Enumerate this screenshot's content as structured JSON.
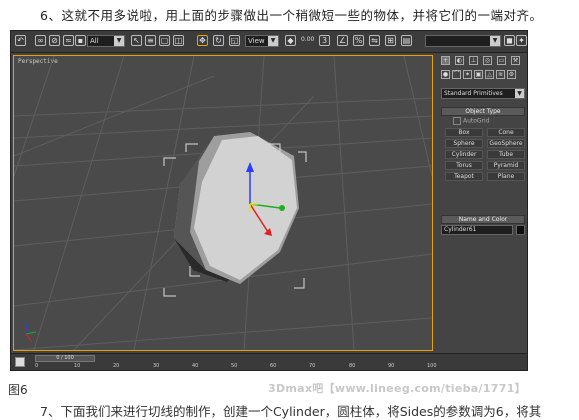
{
  "instruction_top": "6、这就不用多说啦，用上面的步骤做出一个稍微短一些的物体，并将它们的一端对齐。",
  "toolbar": {
    "selection_filter": "All",
    "reference_coord": "View",
    "icons": [
      "undo-icon",
      "link-icon",
      "unlink-icon",
      "bind-icon",
      "select-icon",
      "select-by-name-icon",
      "rect-region-icon",
      "window-crossing-icon",
      "move-icon",
      "rotate-icon",
      "scale-icon",
      "pivot-icon",
      "mirror-icon",
      "align-icon",
      "snap-icon",
      "angle-snap-icon",
      "percent-snap-icon",
      "spinner-snap-icon",
      "named-sets-icon",
      "render-icon",
      "teapot-icon"
    ],
    "snap_value": "0.00"
  },
  "viewport": {
    "label": "Perspective",
    "accent_color": "#e8a300",
    "grid_color": "#5b5b5b"
  },
  "command_panel": {
    "tabs": [
      "create-icon",
      "modify-icon",
      "hierarchy-icon",
      "motion-icon",
      "display-icon",
      "utilities-icon"
    ],
    "subcategory_icons": [
      "geometry-icon",
      "shapes-icon",
      "lights-icon",
      "cameras-icon",
      "helpers-icon",
      "spacewarps-icon",
      "systems-icon"
    ],
    "category_select": "Standard Primitives",
    "object_type_header": "Object Type",
    "autogrid_label": "AutoGrid",
    "primitives": [
      "Box",
      "Cone",
      "Sphere",
      "GeoSphere",
      "Cylinder",
      "Tube",
      "Torus",
      "Pyramid",
      "Teapot",
      "Plane"
    ],
    "name_color_header": "Name and Color",
    "object_name": "Cylinder61",
    "object_color": "#111111"
  },
  "timeline": {
    "frame_readout": "0 / 100",
    "ticks": [
      "0",
      "10",
      "20",
      "30",
      "40",
      "50",
      "60",
      "70",
      "80",
      "90",
      "100"
    ]
  },
  "caption": "图6",
  "watermark": "3Dmax吧【www.lineeg.com/tieba/1771】",
  "instruction_bottom": "7、下面我们来进行切线的制作，创建一个Cylinder，圆柱体，将Sides的参数调为6，将其"
}
